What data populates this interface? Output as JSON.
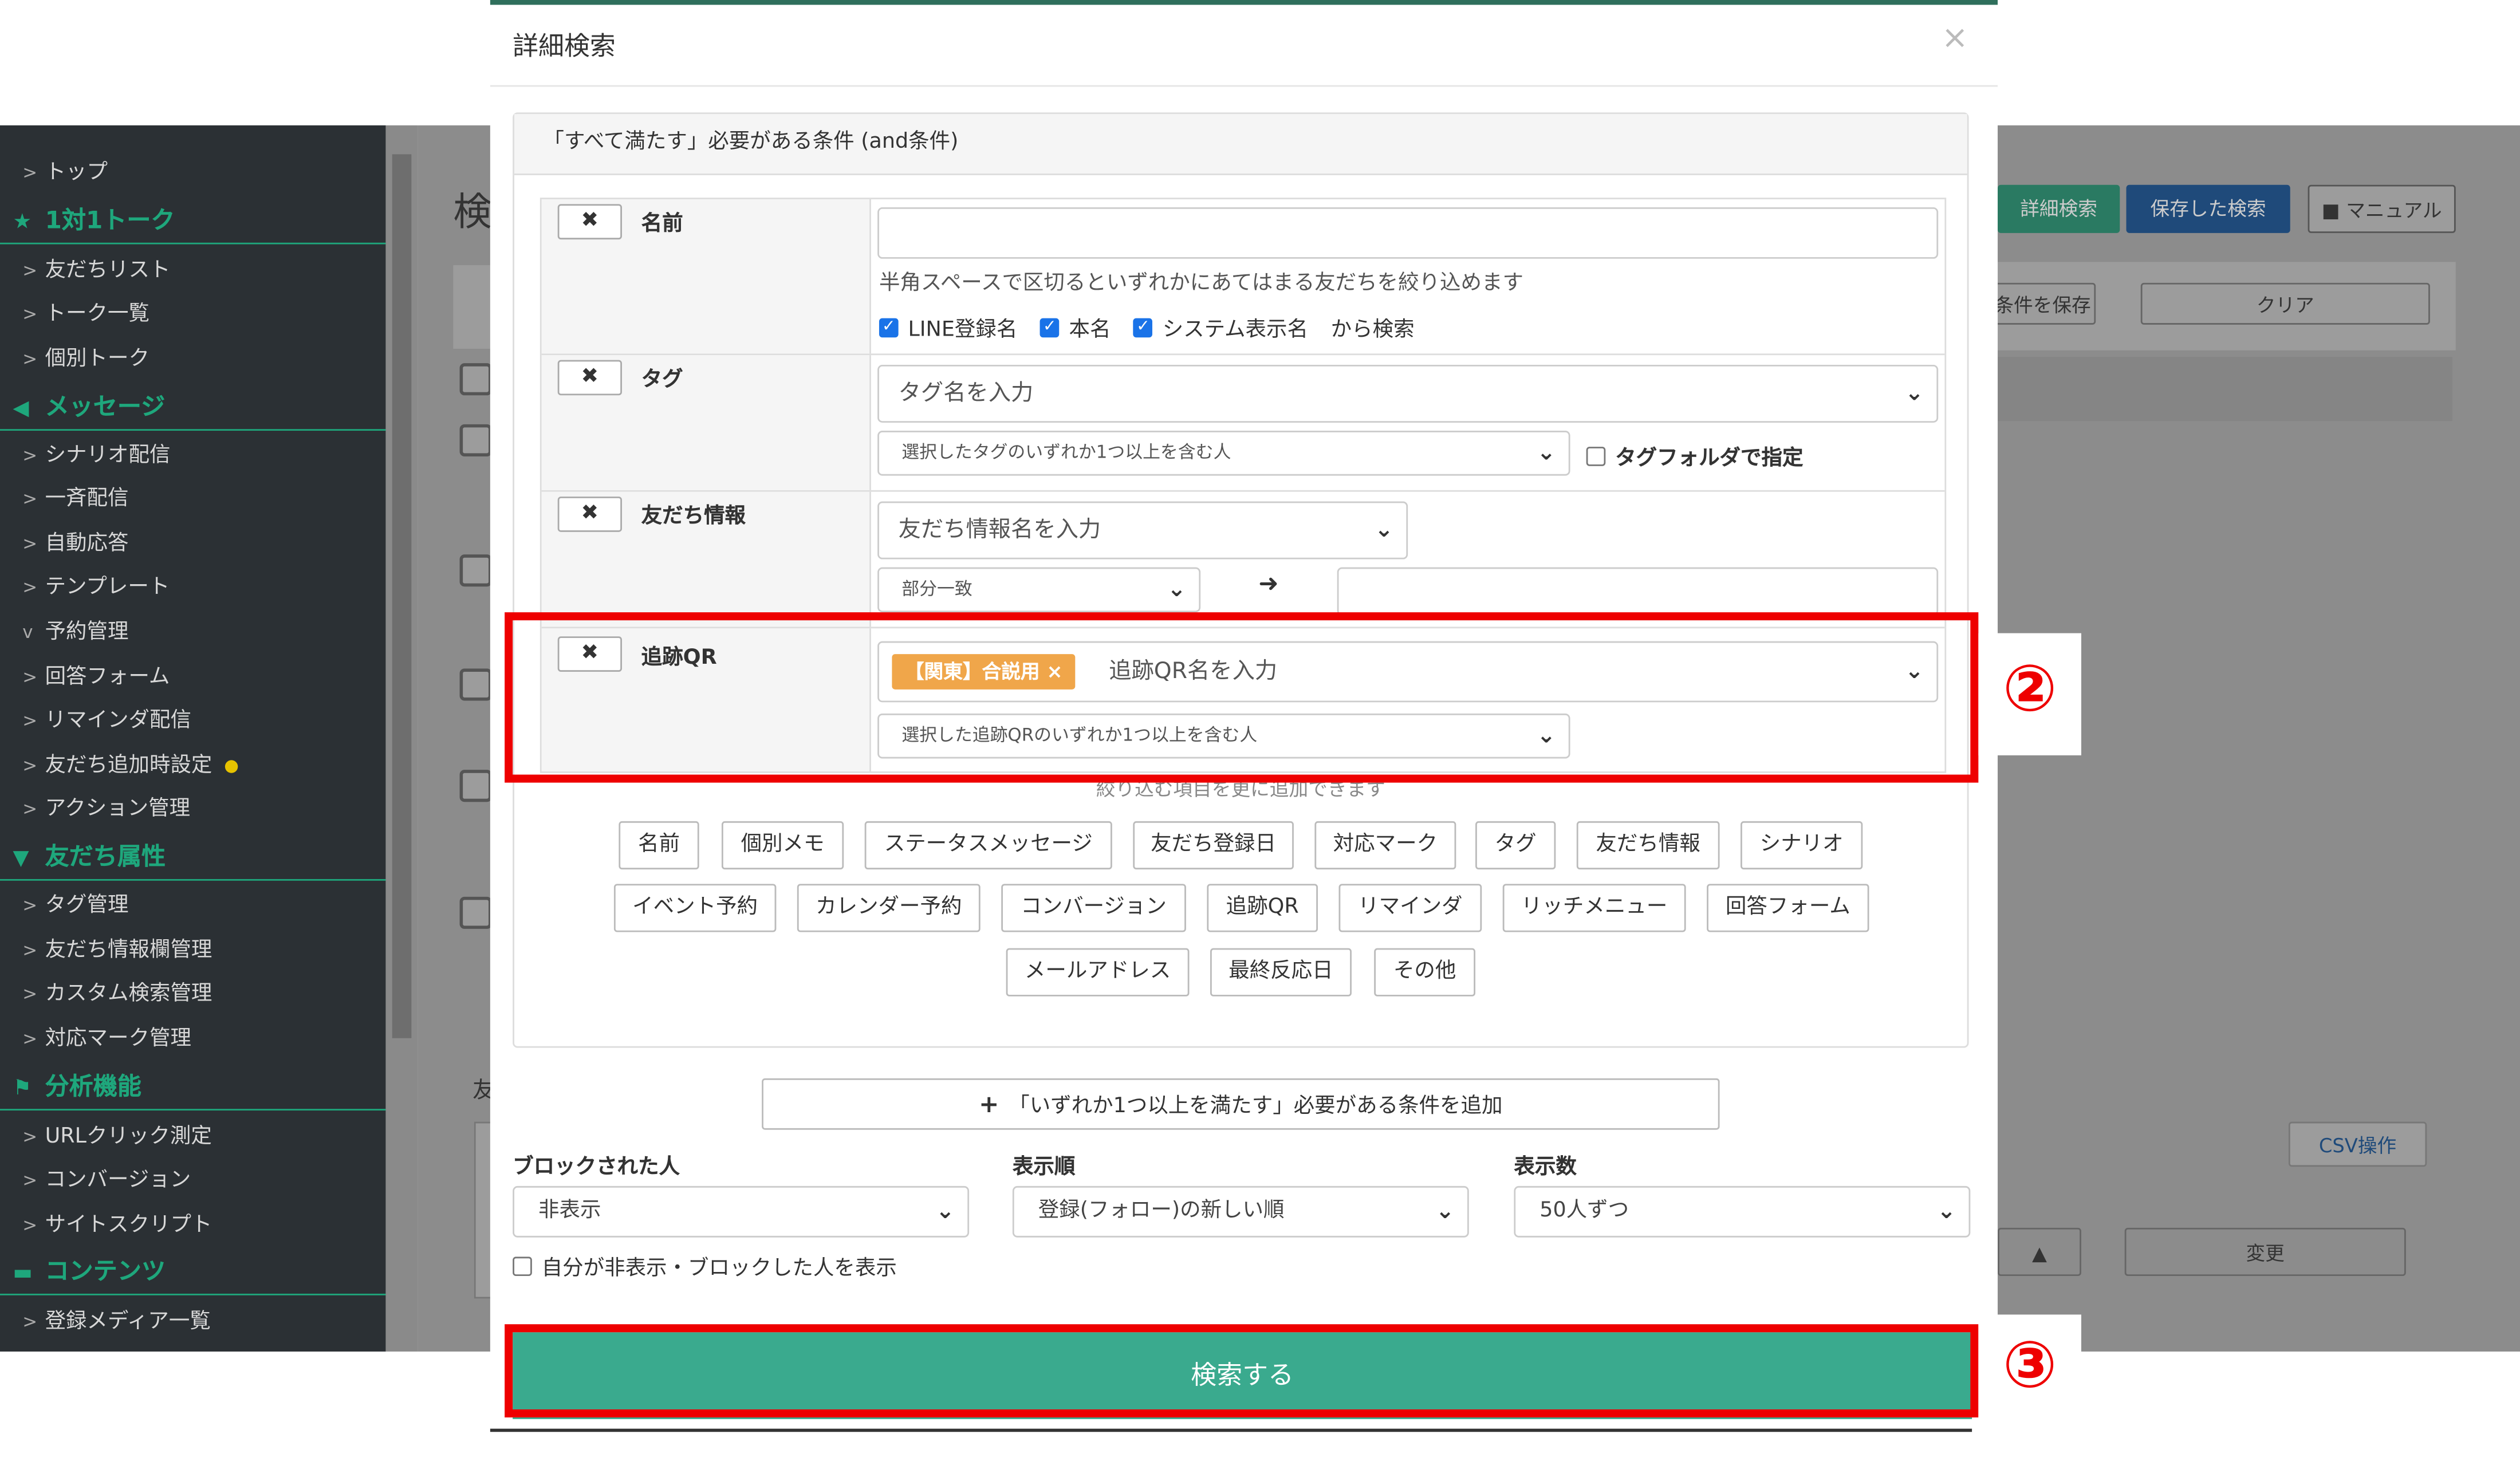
{
  "sidebar": {
    "top": "トップ",
    "section_talk": "1対1トーク",
    "friend_list": "友だちリスト",
    "talk_list": "トーク一覧",
    "individual_talk": "個別トーク",
    "section_message": "メッセージ",
    "scenario": "シナリオ配信",
    "broadcast": "一斉配信",
    "auto_reply": "自動応答",
    "template": "テンプレート",
    "reservation": "予約管理",
    "answer_form": "回答フォーム",
    "reminder": "リマインダ配信",
    "friend_add_settings": "友だち追加時設定",
    "action_mgmt": "アクション管理",
    "section_attr": "友だち属性",
    "tag_mgmt": "タグ管理",
    "friend_info_mgmt": "友だち情報欄管理",
    "custom_search_mgmt": "カスタム検索管理",
    "mark_mgmt": "対応マーク管理",
    "section_analysis": "分析機能",
    "url_click": "URLクリック測定",
    "conversion": "コンバージョン",
    "site_script": "サイトスクリプト",
    "section_contents": "コンテンツ",
    "media_list": "登録メディア一覧"
  },
  "background": {
    "page_title": "検",
    "detail_search_btn": "詳細検索",
    "saved_search_btn": "保存した検索",
    "manual_btn": "マニュアル",
    "save_condition_btn": "条件を保存",
    "clear_btn": "クリア",
    "friends_label": "友",
    "csv_tab": "CSV操作",
    "change_btn": "変更"
  },
  "modal": {
    "title": "詳細検索",
    "close": "×",
    "and_header": "「すべて満たす」必要がある条件 (and条件)",
    "conditions": {
      "name": {
        "remove": "✖",
        "label": "名前",
        "value": "",
        "help": "半角スペースで区切るといずれかにあてはまる友だちを絞り込めます",
        "cb_line": "LINE登録名",
        "cb_real": "本名",
        "cb_system": "システム表示名",
        "suffix": "から検索"
      },
      "tag": {
        "remove": "✖",
        "label": "タグ",
        "placeholder": "タグ名を入力",
        "match": "選択したタグのいずれか1つ以上を含む人",
        "folder_cb": "タグフォルダで指定"
      },
      "friend_info": {
        "remove": "✖",
        "label": "友だち情報",
        "placeholder": "友だち情報名を入力",
        "match": "部分一致",
        "arrow": "➜",
        "value": ""
      },
      "qr": {
        "remove": "✖",
        "label": "追跡QR",
        "chip": "【関東】合説用",
        "chip_remove": "×",
        "placeholder": "追跡QR名を入力",
        "match": "選択した追跡QRのいずれか1つ以上を含む人"
      }
    },
    "add_note": "絞り込む項目を更に追加できます",
    "add_buttons": {
      "row1": [
        "名前",
        "個別メモ",
        "ステータスメッセージ",
        "友だち登録日",
        "対応マーク",
        "タグ",
        "友だち情報",
        "シナリオ"
      ],
      "row2": [
        "イベント予約",
        "カレンダー予約",
        "コンバージョン",
        "追跡QR",
        "リマインダ",
        "リッチメニュー",
        "回答フォーム"
      ],
      "row3": [
        "メールアドレス",
        "最終反応日",
        "その他"
      ]
    },
    "or_button": {
      "plus": "+",
      "label": "「いずれか1つ以上を満たす」必要がある条件を追加"
    },
    "blocked": {
      "label": "ブロックされた人",
      "value": "非表示",
      "self_hide_cb": "自分が非表示・ブロックした人を表示"
    },
    "order": {
      "label": "表示順",
      "value": "登録(フォロー)の新しい順"
    },
    "count": {
      "label": "表示数",
      "value": "50人ずつ"
    },
    "search_button": "検索する"
  },
  "annotations": {
    "step2": "②",
    "step3": "③",
    "color": "#ee0000"
  },
  "colors": {
    "accent": "#3aaa8e",
    "sidebar_bg": "#2b3034",
    "sidebar_head": "#1ea77c",
    "chip": "#f0a64a",
    "checkbox": "#1a73e8"
  }
}
